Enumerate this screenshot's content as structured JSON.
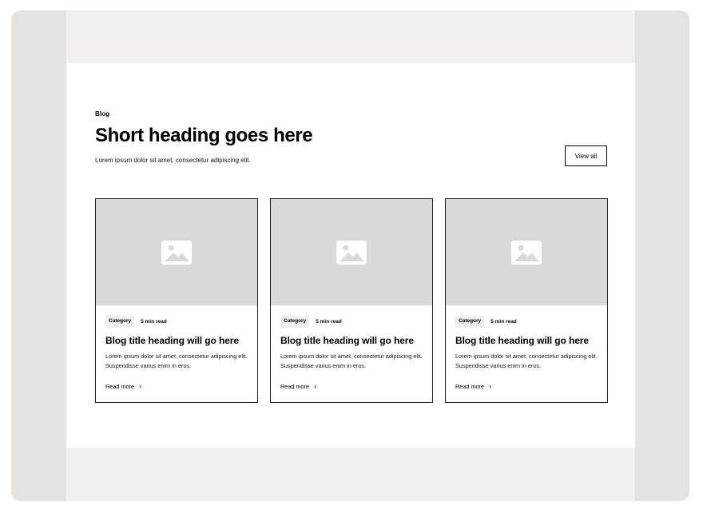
{
  "header": {
    "tagline": "Blog",
    "heading": "Short heading goes here",
    "description": "Lorem ipsum dolor sit amet, consectetur adipiscing elit.",
    "view_all_label": "View all"
  },
  "cards": [
    {
      "image_icon": "image-placeholder-icon",
      "category": "Category",
      "read_time": "5 min read",
      "title": "Blog title heading will go here",
      "description": "Lorem ipsum dolor sit amet, consectetur adipiscing elit. Suspendisse varius enim in eros.",
      "link_label": "Read more",
      "link_icon": "chevron-right-icon"
    },
    {
      "image_icon": "image-placeholder-icon",
      "category": "Category",
      "read_time": "5 min read",
      "title": "Blog title heading will go here",
      "description": "Lorem ipsum dolor sit amet, consectetur adipiscing elit. Suspendisse varius enim in eros.",
      "link_label": "Read more",
      "link_icon": "chevron-right-icon"
    },
    {
      "image_icon": "image-placeholder-icon",
      "category": "Category",
      "read_time": "5 min read",
      "title": "Blog title heading will go here",
      "description": "Lorem ipsum dolor sit amet, consectetur adipiscing elit. Suspendisse varius enim in eros.",
      "link_label": "Read more",
      "link_icon": "chevron-right-icon"
    }
  ],
  "colors": {
    "outer_frame": "#e4e3df",
    "canvas": "#f1f0ee",
    "section": "#ffffff",
    "image_placeholder": "#d9d9d9",
    "icon": "#ffffff",
    "border": "#222222"
  }
}
